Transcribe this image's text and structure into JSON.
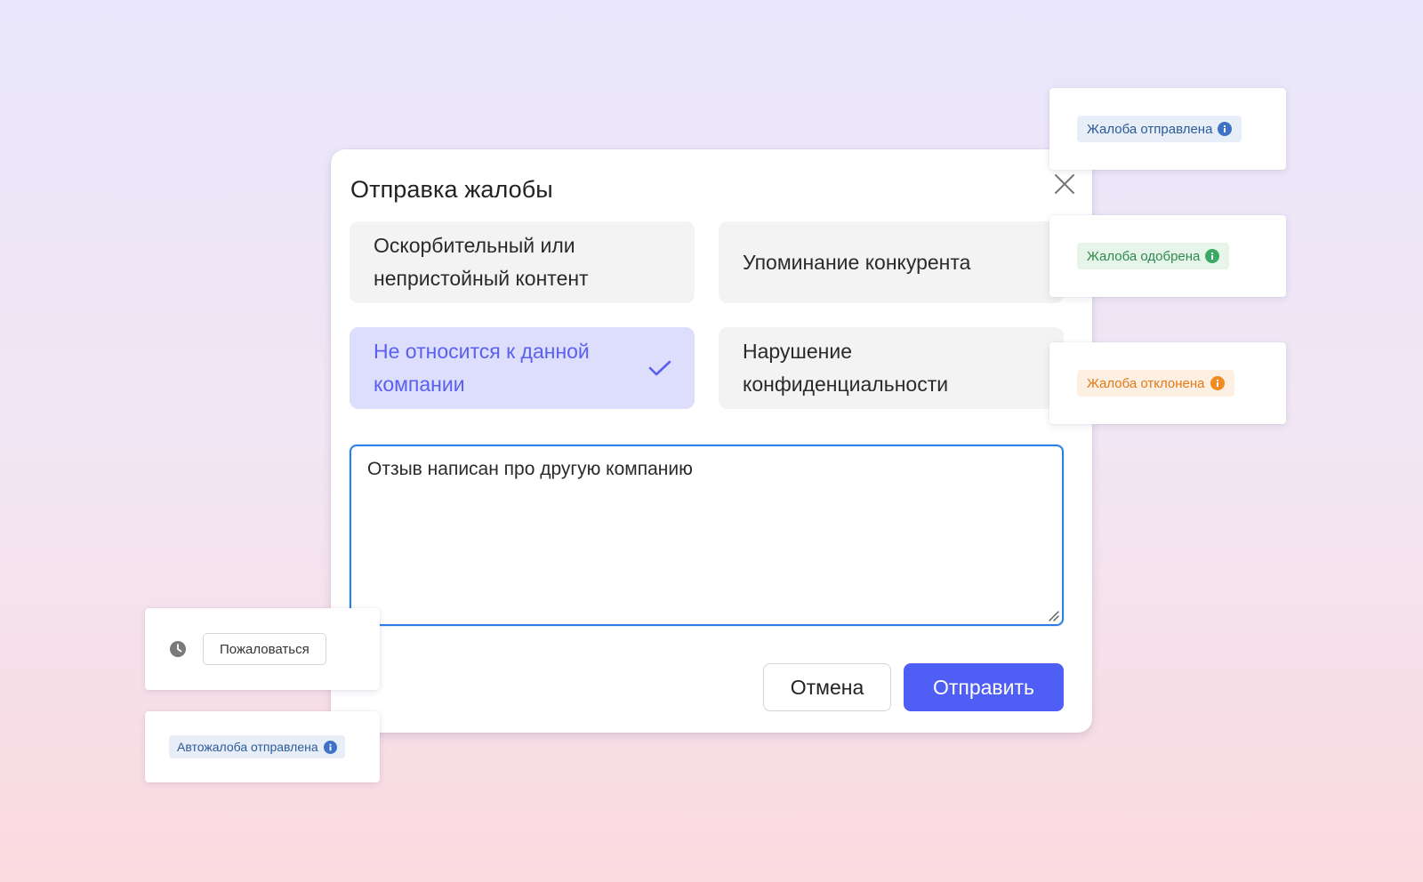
{
  "dialog": {
    "title": "Отправка жалобы",
    "options": [
      {
        "label": "Оскорбительный или непристойный контент",
        "selected": false
      },
      {
        "label": "Упоминание конкурента",
        "selected": false
      },
      {
        "label": "Не относится к данной компании",
        "selected": true
      },
      {
        "label": "Нарушение конфиденциальности",
        "selected": false
      }
    ],
    "comment_value": "Отзыв написан про другую компанию",
    "cancel_label": "Отмена",
    "submit_label": "Отправить"
  },
  "status_cards": {
    "sent": "Жалоба отправлена",
    "approved": "Жалоба одобрена",
    "rejected": "Жалоба отклонена"
  },
  "complain_card": {
    "button_label": "Пожаловаться"
  },
  "auto_card": {
    "badge": "Автожалоба отправлена"
  },
  "colors": {
    "accent": "#4f5ef5",
    "selected_bg": "#dcdefb",
    "selected_text": "#5b5ff0",
    "info_blue": "#3d72c6",
    "success_green": "#3aa963",
    "warning_orange": "#f08c22"
  },
  "icons": [
    "close-icon",
    "check-icon",
    "info-icon",
    "clock-icon",
    "resize-handle-icon"
  ]
}
